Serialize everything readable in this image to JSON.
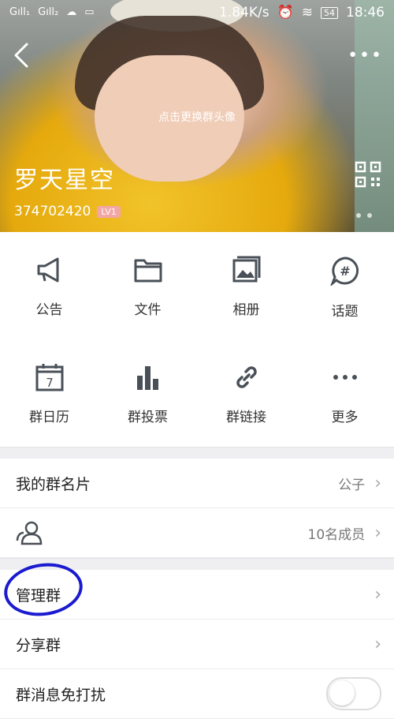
{
  "status_bar": {
    "left": [
      "Gıll₁",
      "Gıll₂"
    ],
    "speed": "1.84K/s",
    "battery": "54",
    "time": "18:46"
  },
  "header": {
    "change_avatar": "点击更换群头像",
    "group_name": "罗天星空",
    "group_id": "374702420",
    "level": "LV1"
  },
  "features": [
    {
      "label": "公告",
      "icon": "megaphone-icon"
    },
    {
      "label": "文件",
      "icon": "folder-icon"
    },
    {
      "label": "相册",
      "icon": "album-icon"
    },
    {
      "label": "话题",
      "icon": "hashtag-icon"
    },
    {
      "label": "群日历",
      "icon": "calendar-icon"
    },
    {
      "label": "群投票",
      "icon": "bar-chart-icon"
    },
    {
      "label": "群链接",
      "icon": "link-icon"
    },
    {
      "label": "更多",
      "icon": "more-icon"
    }
  ],
  "calendar_day": "7",
  "rows": {
    "card": {
      "label": "我的群名片",
      "value": "公子"
    },
    "members": {
      "value": "10名成员"
    },
    "manage": {
      "label": "管理群"
    },
    "share": {
      "label": "分享群"
    },
    "mute": {
      "label": "群消息免打扰",
      "enabled": false
    }
  },
  "colors": {
    "highlight_circle": "#1a1ad0"
  }
}
